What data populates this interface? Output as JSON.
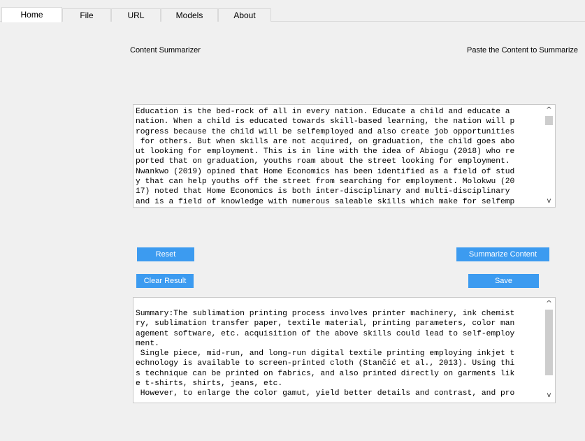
{
  "tabs": [
    {
      "label": "Home",
      "active": true
    },
    {
      "label": "File",
      "active": false
    },
    {
      "label": "URL",
      "active": false
    },
    {
      "label": "Models",
      "active": false
    },
    {
      "label": "About",
      "active": false
    }
  ],
  "page": {
    "title": "Content Summarizer",
    "instruction": "Paste the Content to Summarize"
  },
  "input_text": {
    "lines": [
      "Education is the bed-rock of all in every nation. Educate a child and educate a",
      "nation. When a child is educated towards skill-based learning, the nation will p",
      "rogress because the child will be selfemployed and also create job opportunities",
      " for others. But when skills are not acquired, on graduation, the child goes abo",
      "ut looking for employment. This is in line with the idea of Abiogu (2018) who re",
      "ported that on graduation, youths roam about the street looking for employment.",
      "Nwankwo (2019) opined that Home Economics has been identified as a field of stud",
      "y that can help youths off the street from searching for employment. Molokwu (20",
      "17) noted that Home Economics is both inter-disciplinary and multi-disciplinary",
      "and is a field of knowledge with numerous saleable skills which make for selfemp"
    ]
  },
  "buttons": {
    "reset": "Reset",
    "summarize": "Summarize Content",
    "clear": "Clear Result",
    "save": "Save"
  },
  "summary_text": {
    "lines": [
      "Summary:The sublimation printing process involves printer machinery, ink chemist",
      "ry, sublimation transfer paper, textile material, printing parameters, color man",
      "agement software, etc. acquisition of the above skills could lead to self-employ",
      "ment.",
      " Single piece, mid-run, and long-run digital textile printing employing inkjet t",
      "echnology is available to screen-printed cloth (Stančić et al., 2013). Using thi",
      "s technique can be printed on fabrics, and also printed directly on garments lik",
      "e t-shirts, shirts, jeans, etc.",
      " However, to enlarge the color gamut, yield better details and contrast, and pro"
    ]
  },
  "scroll": {
    "up_glyph": "^",
    "down_glyph": "v",
    "input_position": 0.0,
    "summary_position": 0.0
  },
  "colors": {
    "button_bg": "#3c9bf0",
    "button_text": "#ffffff",
    "window_bg": "#f0f0f0"
  }
}
